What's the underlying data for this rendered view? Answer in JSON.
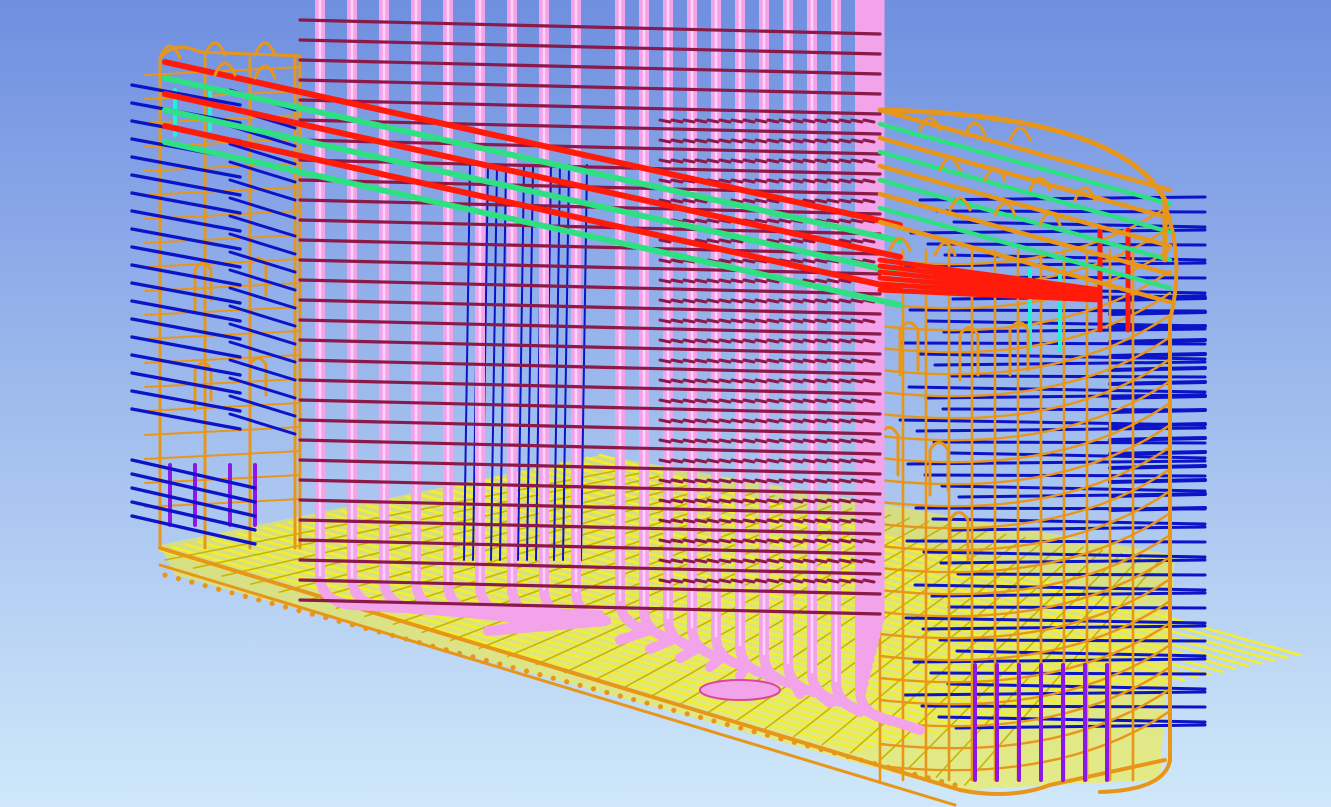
{
  "viewport": {
    "background_top": "#6f8fe0",
    "background_bottom": "#cfe8fa"
  },
  "materials": {
    "column_bar": "#f3a3ea",
    "column_tie": "#8a1a4a",
    "slab_bottom": "#f5ef2a",
    "slab_bottom_deep": "#c9b400",
    "stirrup": "#e8961a",
    "stirrup_dark": "#b86a00",
    "top_red": "#ff1a0a",
    "top_green": "#2ee082",
    "cyan": "#22f0d8",
    "blue_bar": "#0c14c8",
    "purple_bar": "#8a18e6"
  }
}
